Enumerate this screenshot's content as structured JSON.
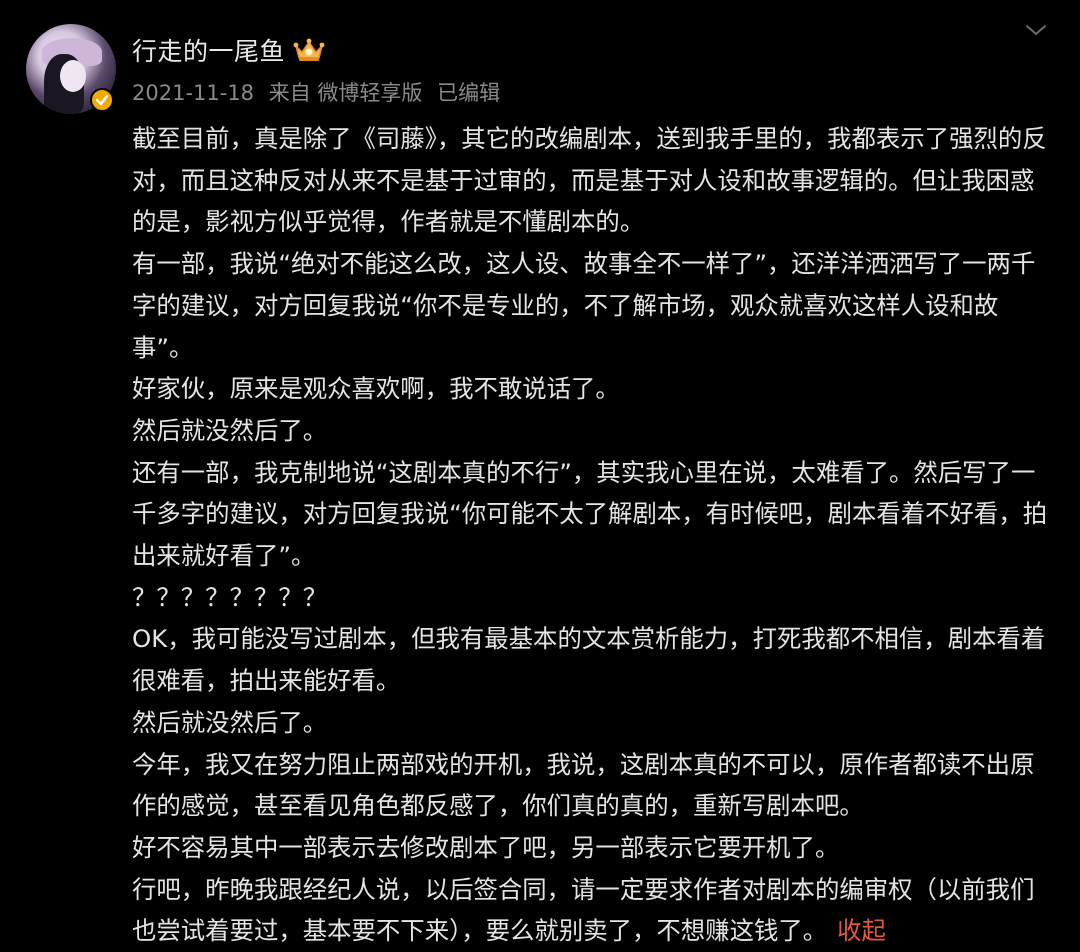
{
  "post": {
    "username": "行走的一尾鱼",
    "meta": {
      "date": "2021-11-18",
      "source": "来自 微博轻享版",
      "edited": "已编辑"
    },
    "icons": {
      "verified": "verified-badge-icon",
      "member": "member-crown-icon",
      "expand": "chevron-down-icon"
    },
    "colors": {
      "background": "#000000",
      "text": "#e4e4e4",
      "meta": "#8a8a8a",
      "verified": "#f2a900",
      "collapse_link": "#e5583f"
    },
    "paragraphs": [
      "截至目前，真是除了《司藤》，其它的改编剧本，送到我手里的，我都表示了强烈的反对，而且这种反对从来不是基于过审的，而是基于对人设和故事逻辑的。但让我困惑的是，影视方似乎觉得，作者就是不懂剧本的。",
      "有一部，我说“绝对不能这么改，这人设、故事全不一样了”，还洋洋洒洒写了一两千字的建议，对方回复我说“你不是专业的，不了解市场，观众就喜欢这样人设和故事”。",
      "好家伙，原来是观众喜欢啊，我不敢说话了。",
      "然后就没然后了。",
      "还有一部，我克制地说“这剧本真的不行”，其实我心里在说，太难看了。然后写了一千多字的建议，对方回复我说“你可能不太了解剧本，有时候吧，剧本看着不好看，拍出来就好看了”。",
      "？？？？？？？？",
      "OK，我可能没写过剧本，但我有最基本的文本赏析能力，打死我都不相信，剧本看着很难看，拍出来能好看。",
      "然后就没然后了。",
      "今年，我又在努力阻止两部戏的开机，我说，这剧本真的不可以，原作者都读不出原作的感觉，甚至看见角色都反感了，你们真的真的，重新写剧本吧。",
      "好不容易其中一部表示去修改剧本了吧，另一部表示它要开机了。"
    ],
    "last_paragraph": "行吧，昨晚我跟经纪人说，以后签合同，请一定要求作者对剧本的编审权（以前我们也尝试着要过，基本要不下来），要么就别卖了，不想赚这钱了。",
    "collapse_label": "收起"
  }
}
